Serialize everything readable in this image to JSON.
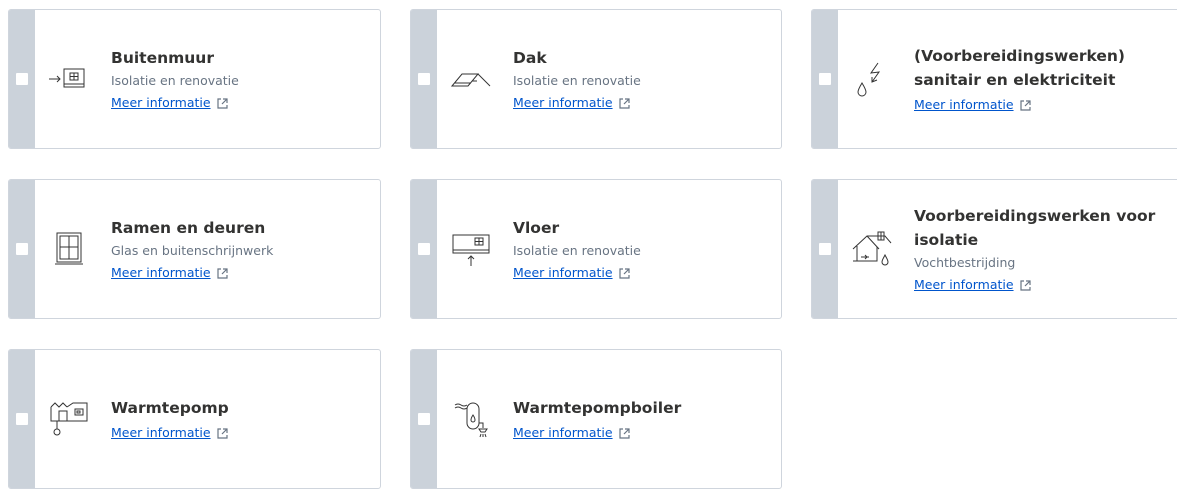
{
  "cards": [
    {
      "title": "Buitenmuur",
      "subtitle": "Isolatie en renovatie",
      "more": "Meer informatie",
      "icon": "outer-wall-icon"
    },
    {
      "title": "Dak",
      "subtitle": "Isolatie en renovatie",
      "more": "Meer informatie",
      "icon": "roof-icon"
    },
    {
      "title": "(Voorbereidingswerken) sanitair en elektriciteit",
      "subtitle": "",
      "more": "Meer informatie",
      "icon": "water-electricity-icon"
    },
    {
      "title": "Ramen en deuren",
      "subtitle": "Glas en buitenschrijnwerk",
      "more": "Meer informatie",
      "icon": "window-icon"
    },
    {
      "title": "Vloer",
      "subtitle": "Isolatie en renovatie",
      "more": "Meer informatie",
      "icon": "floor-icon"
    },
    {
      "title": "Voorbereidingswerken voor isolatie",
      "subtitle": "Vochtbestrijding",
      "more": "Meer informatie",
      "icon": "house-moisture-icon"
    },
    {
      "title": "Warmtepomp",
      "subtitle": "",
      "more": "Meer informatie",
      "icon": "heat-pump-icon"
    },
    {
      "title": "Warmtepompboiler",
      "subtitle": "",
      "more": "Meer informatie",
      "icon": "heat-pump-boiler-icon"
    }
  ],
  "colors": {
    "rail": "#cbd2da",
    "border": "#cfd5dd",
    "link": "#0055cc",
    "title": "#333332",
    "subtitle": "#687483"
  }
}
